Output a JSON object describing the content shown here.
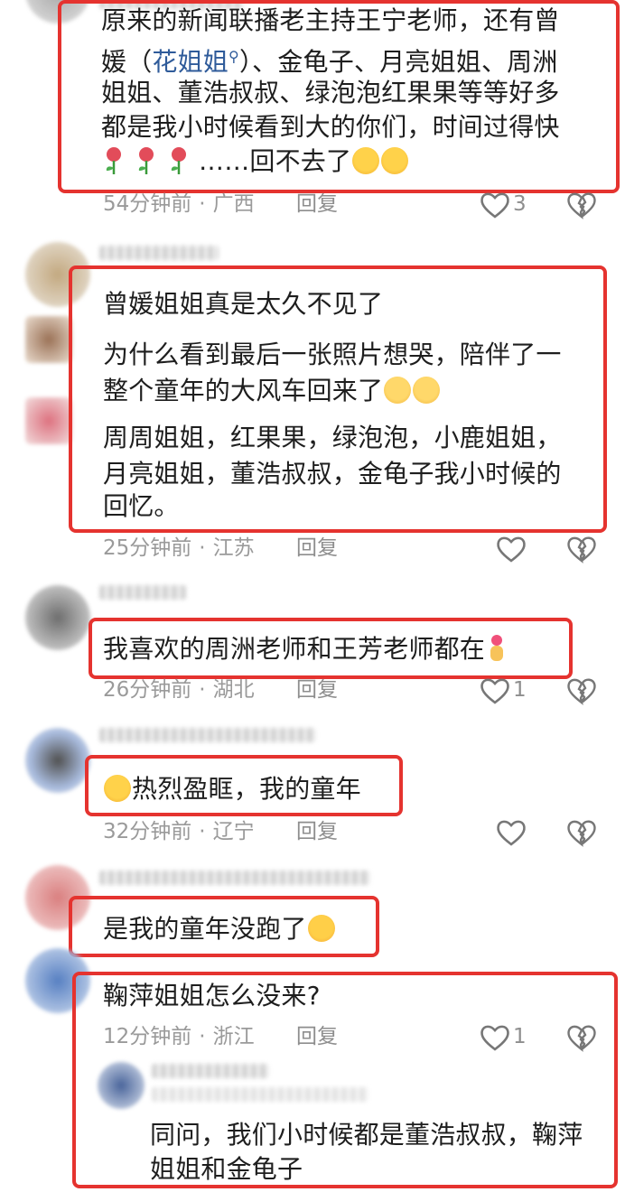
{
  "colors": {
    "highlight_border": "#e5332f",
    "meta_text": "#9a9a9a",
    "link": "#2f5b9a"
  },
  "comments": [
    {
      "lines": [
        "原来的新闻联播老主持王宁老师，还有曾",
        "媛（",
        "花姐姐",
        "）、金龟子、月亮姐姐、周洲",
        "姐姐、董浩叔叔、绿泡泡红果果等等好多",
        "都是我小时候看到大的你们，时间过得快",
        "……回不去了"
      ],
      "time": "54分钟前",
      "location": "广西",
      "reply": "回复",
      "likes": "3",
      "icons": [
        "rose-emoji",
        "crying-emoji"
      ]
    },
    {
      "paragraphs": [
        "曾媛姐姐真是太久不见了",
        "为什么看到最后一张照片想哭，陪伴了一",
        "整个童年的大风车回来了",
        "周周姐姐，红果果，绿泡泡，小鹿姐姐，",
        "月亮姐姐，董浩叔叔，金龟子我小时候的",
        "回忆。"
      ],
      "time": "25分钟前",
      "location": "江苏",
      "reply": "回复",
      "likes": "",
      "icons": [
        "pleading-face-emoji"
      ]
    },
    {
      "text": "我喜欢的周洲老师和王芳老师都在",
      "time": "26分钟前",
      "location": "湖北",
      "reply": "回复",
      "likes": "1",
      "icons": [
        "finger-heart-emoji"
      ]
    },
    {
      "text": "热烈盈眶，我的童年",
      "time": "32分钟前",
      "location": "辽宁",
      "reply": "回复",
      "likes": "",
      "icons": [
        "crying-emoji"
      ]
    },
    {
      "text": "是我的童年没跑了",
      "time": "",
      "location": "",
      "reply": "",
      "likes": "",
      "icons": [
        "hugging-face-emoji"
      ]
    },
    {
      "text": "鞠萍姐姐怎么没来?",
      "time": "12分钟前",
      "location": "浙江",
      "reply": "回复",
      "likes": "1",
      "sub_reply": {
        "lines": [
          "同问，我们小时候都是董浩叔叔，鞠萍",
          "姐姐和金龟子"
        ]
      }
    }
  ],
  "search_icon": "search-icon"
}
